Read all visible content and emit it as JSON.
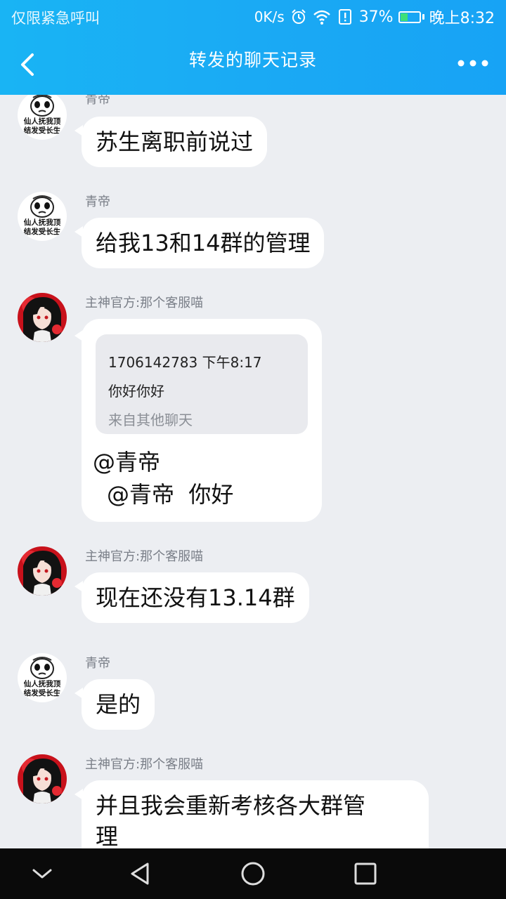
{
  "status_bar": {
    "left_text": "仅限紧急呼叫",
    "net_speed": "0K/s",
    "battery_pct": "37%",
    "battery_level": 0.37,
    "time": "晚上8:32",
    "icons": [
      "alarm-icon",
      "wifi-icon",
      "alert-icon",
      "battery-icon"
    ]
  },
  "header": {
    "title": "转发的聊天记录",
    "back_icon": "chevron-left-icon",
    "more_icon": "more-dots-icon"
  },
  "messages": [
    {
      "sender": "青帝",
      "text": "苏生离职前说过",
      "avatar": "meme-avatar"
    },
    {
      "sender": "青帝",
      "text": "给我13和14群的管理",
      "avatar": "meme-avatar"
    },
    {
      "sender": "主神官方:那个客服喵",
      "avatar": "anime-avatar",
      "quote": {
        "head": "1706142783 下午8:17",
        "body": "你好你好",
        "source": "来自其他聊天"
      },
      "reply_line1": "@青帝",
      "reply_line2": "@青帝  你好"
    },
    {
      "sender": "主神官方:那个客服喵",
      "text": "现在还没有13.14群",
      "avatar": "anime-avatar"
    },
    {
      "sender": "青帝",
      "text": "是的",
      "avatar": "meme-avatar"
    },
    {
      "sender": "主神官方:那个客服喵",
      "text_line1": "并且我会重新考核各大群管",
      "text_line2": "理",
      "avatar": "anime-avatar"
    }
  ],
  "avatar_text": {
    "line1": "仙人抚我顶",
    "line2": "结发受长生"
  },
  "navbar": {
    "icons": [
      "chevron-down-icon",
      "back-triangle-icon",
      "home-circle-icon",
      "recents-square-icon"
    ]
  }
}
